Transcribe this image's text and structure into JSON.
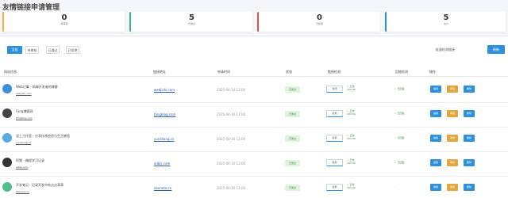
{
  "title": "友情链接申请管理",
  "stats": [
    {
      "value": "0",
      "label": "待审核",
      "color": "#f2b33d"
    },
    {
      "value": "5",
      "label": "已通过",
      "color": "#3fae9f"
    },
    {
      "value": "0",
      "label": "已拒绝",
      "color": "#d9534f"
    },
    {
      "value": "5",
      "label": "总计",
      "color": "#2f8fd8"
    }
  ],
  "tabs": [
    "全部",
    "待审核",
    "已通过",
    "已拒绝"
  ],
  "search_label": "批量检测链接",
  "search_button": "刷新",
  "columns": [
    "网站信息",
    "链接地址",
    "申请时间",
    "状态",
    "链接检测",
    "回链检测",
    "操作"
  ],
  "rows": [
    {
      "name": "Web记事 - 前端开发者的博客",
      "url": "webjishi.com",
      "logo_color": "#3a8fd8",
      "link": "webjishi.com",
      "date": "2025-04-10 12:00",
      "status": "已通过",
      "check_button": "检测",
      "check_result": [
        "✓ 正常",
        "200 OK"
      ],
      "backlink": "✓ 已回链"
    },
    {
      "name": "Fang博客网",
      "url": "fangblog.com",
      "logo_color": "#444444",
      "link": "fangblog.com",
      "date": "2025-04-10 12:00",
      "status": "已通过",
      "check_button": "检测",
      "check_result": [
        "✓ 正常",
        "200 OK"
      ],
      "backlink": "✓ 已回链"
    },
    {
      "name": "云上工作室 - 分享技术经验与生活感悟",
      "url": "yunshang.cn",
      "logo_color": "#5aa9e6",
      "link": "yunshang.cn",
      "date": "2025-04-10 12:00",
      "status": "已通过",
      "check_button": "检测",
      "check_result": [
        "✓ 正常",
        "200 OK"
      ],
      "backlink": "✓ 已回链"
    },
    {
      "name": "阿狸 - 编程学习记录",
      "url": "alibiji.com",
      "logo_color": "#333333",
      "link": "alibiji.com",
      "date": "2025-04-10 12:00",
      "status": "已通过",
      "check_button": "检测",
      "check_result": [
        "✓ 正常",
        "200 OK"
      ],
      "backlink": "✓ 已回链"
    },
    {
      "name": "开发笔记 - 记录开发中的点点滴滴",
      "url": "devnote.cn",
      "logo_color": "#4fbf8a",
      "link": "devnote.cn",
      "date": "2025-04-10 12:00",
      "status": "已通过",
      "check_button": "检测",
      "check_result": [
        "✓ 正常",
        "200 OK"
      ],
      "backlink": "-"
    }
  ],
  "actions": {
    "edit": "编辑",
    "review": "审核",
    "delete": "删除"
  }
}
